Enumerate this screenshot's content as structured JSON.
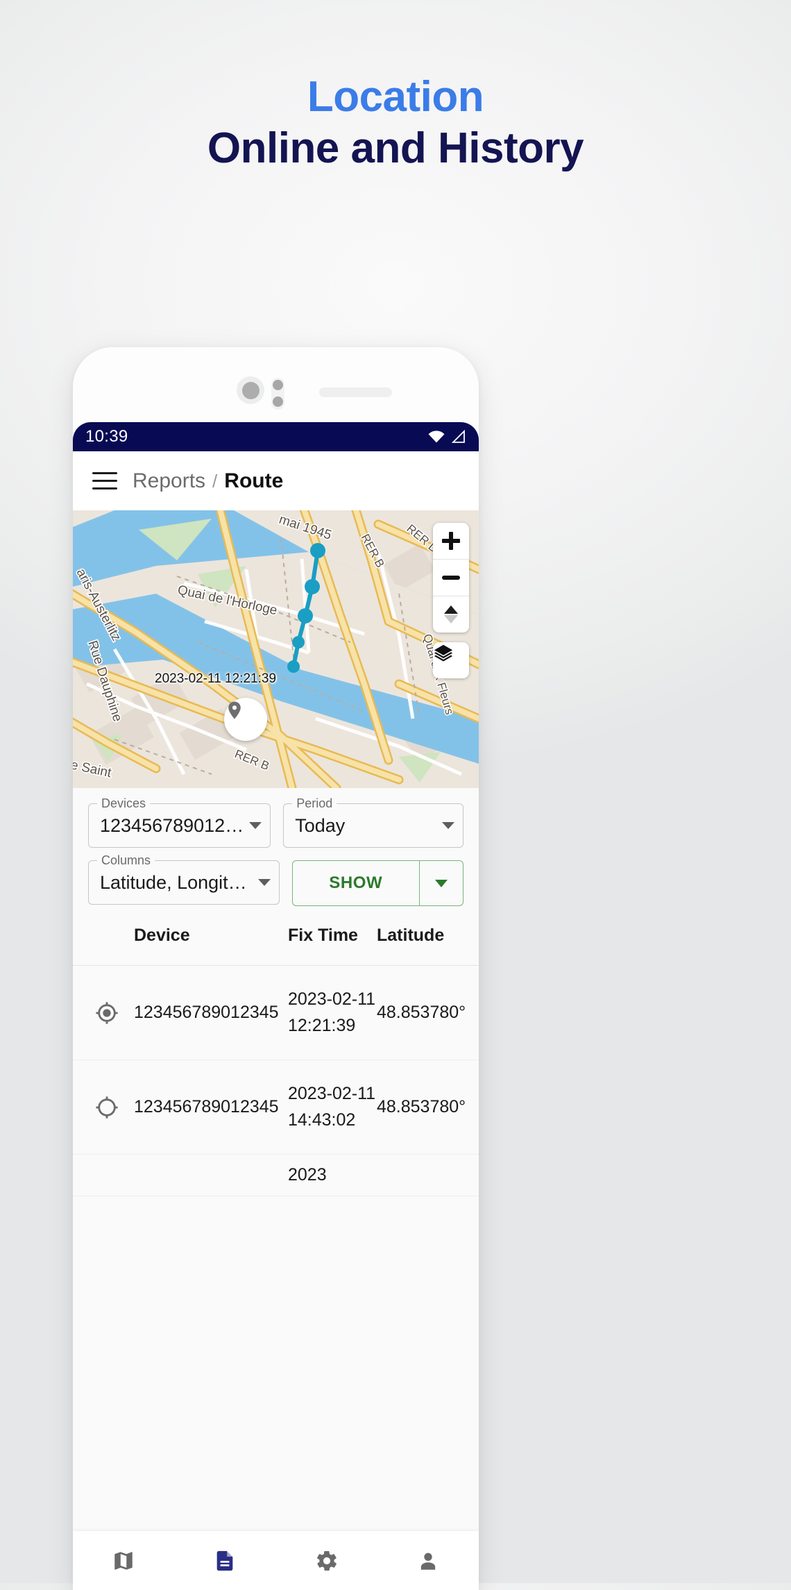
{
  "headline": {
    "line1": "Location",
    "line2": "Online and History",
    "color_line1": "#3b7ce8",
    "color_line2": "#141452"
  },
  "phone": {
    "statusbar": {
      "time": "10:39",
      "background": "#080a53",
      "icons": [
        "wifi-icon",
        "signal-icon"
      ]
    },
    "appbar": {
      "menu_icon": "hamburger-menu-icon",
      "breadcrumb_parent": "Reports",
      "breadcrumb_separator": "/",
      "breadcrumb_current": "Route"
    },
    "map": {
      "marker_label": "2023-02-11 12:21:39",
      "street_labels": [
        "mai 1945",
        "Quai de l'Horloge",
        "Paris-Austerlitz",
        "Rue Dauphine",
        "RER D",
        "RER B",
        "Quai aux Fleurs",
        "e Saint"
      ],
      "controls": {
        "zoom_in": "+",
        "zoom_out": "−",
        "compass": "compass-icon",
        "layers": "layers-icon"
      },
      "route_color": "#1a9ec4",
      "water_color": "#83c2e8"
    },
    "form": {
      "devices": {
        "label": "Devices",
        "value": "123456789012…"
      },
      "period": {
        "label": "Period",
        "value": "Today"
      },
      "columns": {
        "label": "Columns",
        "value": "Latitude, Longit…"
      },
      "show_button": {
        "label": "SHOW",
        "color": "#2b7a2b"
      }
    },
    "table": {
      "headers": [
        "Device",
        "Fix Time",
        "Latitude"
      ],
      "rows": [
        {
          "status_icon": "gps-fixed-icon",
          "device": "123456789012345",
          "fix_time": "2023-02-11 12:21:39",
          "latitude": "48.853780°"
        },
        {
          "status_icon": "gps-not-fixed-icon",
          "device": "123456789012345",
          "fix_time": "2023-02-11 14:43:02",
          "latitude": "48.853780°"
        },
        {
          "status_icon": "gps-not-fixed-icon",
          "device": "",
          "fix_time": "2023",
          "latitude": ""
        }
      ]
    },
    "bottomnav": {
      "items": [
        {
          "icon": "map-icon",
          "active": false
        },
        {
          "icon": "report-document-icon",
          "active": true
        },
        {
          "icon": "settings-gear-icon",
          "active": false
        },
        {
          "icon": "account-person-icon",
          "active": false
        }
      ],
      "active_color": "#2a2f86"
    }
  }
}
